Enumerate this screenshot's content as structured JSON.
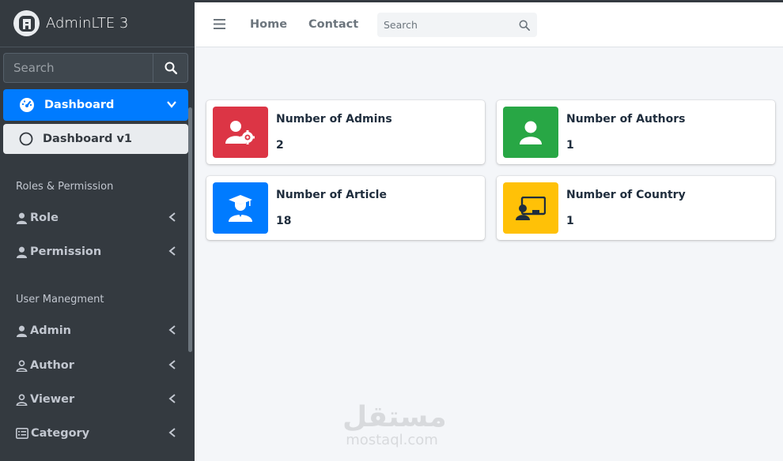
{
  "brand": {
    "title": "AdminLTE 3"
  },
  "sidebar": {
    "search_placeholder": "Search",
    "active_item": "Dashboard",
    "sub_item": "Dashboard v1",
    "sections": [
      {
        "header": "Roles & Permission",
        "items": [
          {
            "label": "Role"
          },
          {
            "label": "Permission"
          }
        ]
      },
      {
        "header": "User Manegment",
        "items": [
          {
            "label": "Admin"
          },
          {
            "label": "Author"
          },
          {
            "label": "Viewer"
          },
          {
            "label": "Category"
          }
        ]
      }
    ]
  },
  "navbar": {
    "links": [
      {
        "label": "Home"
      },
      {
        "label": "Contact"
      }
    ],
    "search_placeholder": "Search"
  },
  "info_boxes": [
    {
      "label": "Number of Admins",
      "value": "2",
      "color": "#dc3545",
      "icon": "users-cog-icon"
    },
    {
      "label": "Number of Authors",
      "value": "1",
      "color": "#28a745",
      "icon": "user-icon"
    },
    {
      "label": "Number of Article",
      "value": "18",
      "color": "#007bff",
      "icon": "user-graduate-icon"
    },
    {
      "label": "Number of Country",
      "value": "1",
      "color": "#ffc107",
      "icon": "chalkboard-teacher-icon"
    }
  ],
  "watermark": {
    "arabic": "مستقل",
    "latin": "mostaql.com"
  }
}
